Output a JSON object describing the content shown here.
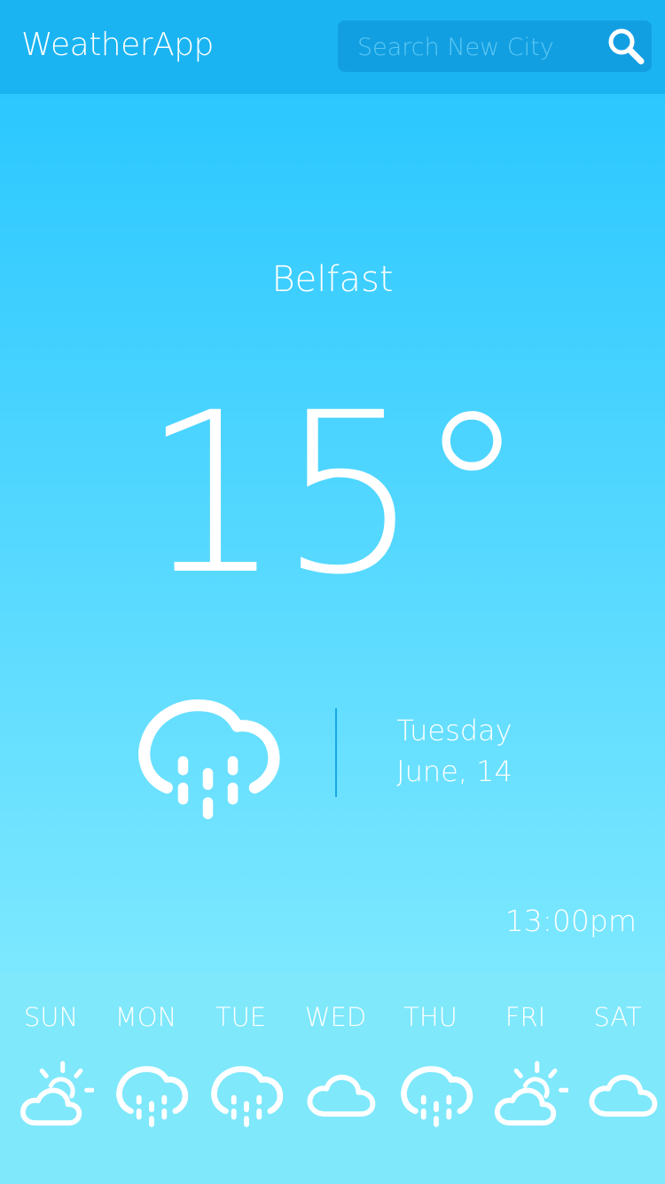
{
  "header": {
    "app_title": "WeatherApp",
    "search_placeholder": "Search New City",
    "search_icon": "search-icon"
  },
  "current": {
    "city": "Belfast",
    "temperature": "15°",
    "condition_icon": "rain-cloud-icon",
    "day": "Tuesday",
    "date": "June, 14",
    "time": "13:00pm"
  },
  "forecast": [
    {
      "day": "SUN",
      "icon": "partly-cloudy-icon"
    },
    {
      "day": "MON",
      "icon": "rain-cloud-icon"
    },
    {
      "day": "TUE",
      "icon": "rain-cloud-icon"
    },
    {
      "day": "WED",
      "icon": "cloud-icon"
    },
    {
      "day": "THU",
      "icon": "rain-cloud-icon"
    },
    {
      "day": "FRI",
      "icon": "partly-cloudy-icon"
    },
    {
      "day": "SAT",
      "icon": "cloud-icon"
    }
  ],
  "colors": {
    "header_bg": "#1ab4f2",
    "search_bg": "#129fe2",
    "forecast_bg": "#7fe8fb",
    "text": "#ffffff"
  }
}
